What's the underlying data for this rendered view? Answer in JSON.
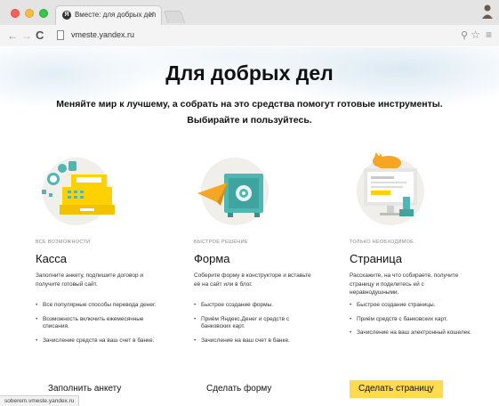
{
  "browser": {
    "tab_title": "Вместе: для добрых дел",
    "tab_favicon": "Я",
    "url": "vmeste.yandex.ru",
    "status_url": "soberem.vmeste.yandex.ru",
    "icons": [
      "back-arrow-icon",
      "forward-arrow-icon",
      "reload-icon",
      "page-icon",
      "zoom-icon",
      "star-icon",
      "menu-icon"
    ]
  },
  "hero": {
    "title": "Для добрых дел",
    "subtitle_line1": "Меняйте мир к лучшему, а собрать на это средства помогут готовые инструменты.",
    "subtitle_line2": "Выбирайте и пользуйтесь."
  },
  "cards": [
    {
      "eyebrow": "Все возможности",
      "title": "Касса",
      "description": "Заполните анкету, подпишите договор и получите готовый сайт.",
      "features": [
        "Все популярные способы перевода денег.",
        "Возможность включить ежемесячные списания.",
        "Зачисление средств на ваш счет в банке."
      ],
      "cta": "Заполнить анкету",
      "illustration": "cash-register-icon"
    },
    {
      "eyebrow": "Быстрое решение",
      "title": "Форма",
      "description": "Соберите форму в конструкторе и вставьте её на сайт или в блог.",
      "features": [
        "Быстрое создание формы.",
        "Приём Яндекс.Денег и средств с банковских карт.",
        "Зачисление на ваш счет в банке."
      ],
      "cta": "Сделать форму",
      "illustration": "safe-with-paper-plane-icon"
    },
    {
      "eyebrow": "Только необходимое",
      "title": "Страница",
      "description": "Расскажите, на что собираете, получите страницу и поделитесь ей с неравнодушными.",
      "features": [
        "Быстрое создание страницы.",
        "Приём средств с банковских карт.",
        "Зачисление на ваш электронный кошелек."
      ],
      "cta": "Сделать страницу",
      "illustration": "monitor-with-cat-icon"
    }
  ],
  "colors": {
    "accent_yellow": "#ffdb4d",
    "teal": "#4fb7b3",
    "orange": "#f5a623",
    "page_bg": "#ffffff"
  }
}
